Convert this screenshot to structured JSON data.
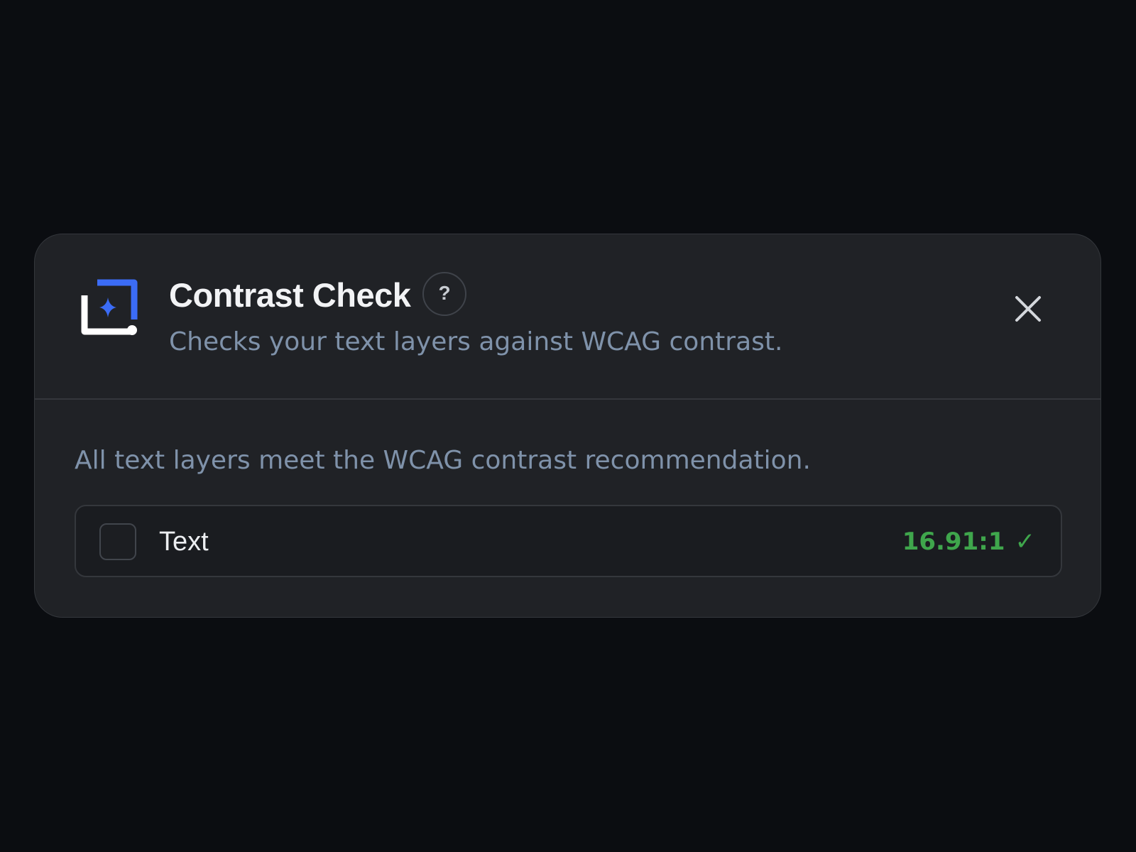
{
  "dialog": {
    "title": "Contrast Check",
    "help_label": "?",
    "subtitle": "Checks your text layers against WCAG contrast.",
    "close_icon": "close-icon",
    "logo_icon": "sparkle-frame-icon"
  },
  "body": {
    "status_message": "All text layers meet the WCAG contrast recommendation.",
    "layers": [
      {
        "name": "Text",
        "ratio": "16.91:1",
        "status_icon": "✓",
        "checked": false
      }
    ]
  },
  "colors": {
    "background": "#0b0d11",
    "panel": "#202226",
    "accent_blue": "#3b6cf6",
    "pass_green": "#3fa64c",
    "muted_text": "#7f92aa"
  }
}
